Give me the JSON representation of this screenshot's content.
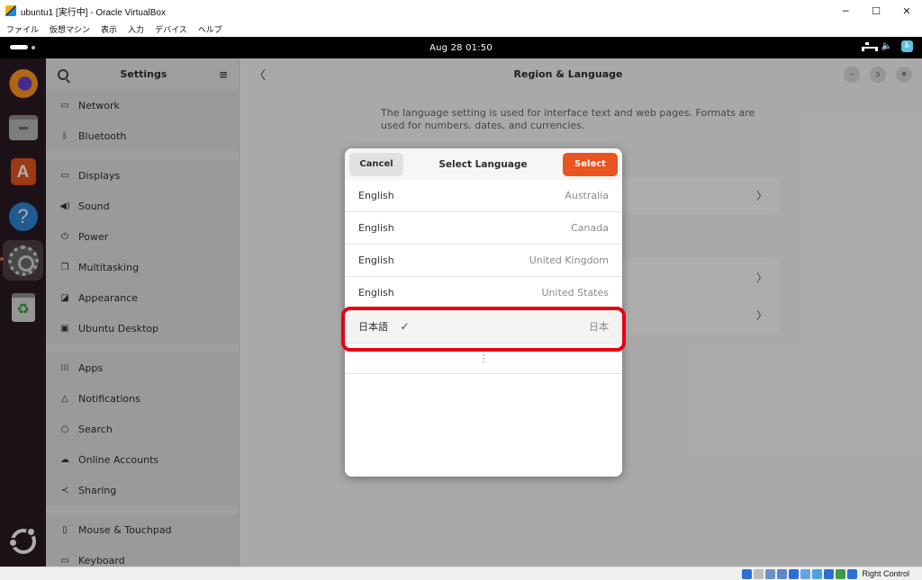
{
  "host": {
    "window_title": "ubuntu1 [実行中] - Oracle VirtualBox",
    "controls": {
      "minimize": "─",
      "maximize": "☐",
      "close": "✕"
    },
    "menu": [
      "ファイル",
      "仮想マシン",
      "表示",
      "入力",
      "デバイス",
      "ヘルプ"
    ],
    "status_hostkey": "Right Control"
  },
  "topbar": {
    "clock": "Aug 28  01:50",
    "tray": {
      "volume": "🔈",
      "accessibility": "♿"
    }
  },
  "dock": {
    "items": [
      {
        "name": "firefox-icon"
      },
      {
        "name": "files-icon"
      },
      {
        "name": "app-center-icon",
        "glyph": "A"
      },
      {
        "name": "help-icon",
        "glyph": "?"
      },
      {
        "name": "settings-icon"
      },
      {
        "name": "trash-icon",
        "glyph": "♻"
      },
      {
        "name": "ubuntu-icon"
      }
    ]
  },
  "settings": {
    "sidebar": {
      "title": "Settings",
      "menu_glyph": "≡",
      "groups": [
        [
          {
            "icon": "▭",
            "label": "Network"
          },
          {
            "icon": "ᛒ",
            "label": "Bluetooth"
          }
        ],
        [
          {
            "icon": "▭",
            "label": "Displays"
          },
          {
            "icon": "◀)",
            "label": "Sound"
          },
          {
            "icon": "⏻",
            "label": "Power"
          },
          {
            "icon": "❐",
            "label": "Multitasking"
          },
          {
            "icon": "◪",
            "label": "Appearance"
          },
          {
            "icon": "▣",
            "label": "Ubuntu Desktop"
          }
        ],
        [
          {
            "icon": "⁞⁞⁞",
            "label": "Apps"
          },
          {
            "icon": "△",
            "label": "Notifications"
          },
          {
            "icon": "○",
            "label": "Search"
          },
          {
            "icon": "☁",
            "label": "Online Accounts"
          },
          {
            "icon": "≺",
            "label": "Sharing"
          }
        ],
        [
          {
            "icon": "▯",
            "label": "Mouse & Touchpad"
          },
          {
            "icon": "▭",
            "label": "Keyboard"
          }
        ]
      ]
    },
    "main": {
      "back_glyph": "〈",
      "title": "Region & Language",
      "description": "The language setting is used for interface text and web pages. Formats are used for numbers, dates, and currencies.",
      "chevron": "〉",
      "window_buttons": [
        "–",
        "ᴐ",
        "✕"
      ]
    }
  },
  "dialog": {
    "title": "Select Language",
    "cancel": "Cancel",
    "select": "Select",
    "languages": [
      {
        "name": "English",
        "region": "Australia"
      },
      {
        "name": "English",
        "region": "Canada"
      },
      {
        "name": "English",
        "region": "United Kingdom"
      },
      {
        "name": "English",
        "region": "United States"
      },
      {
        "name": "日本語",
        "region": "日本",
        "selected": true
      }
    ],
    "check_glyph": "✓",
    "more_glyph": "⋮"
  },
  "colors": {
    "accent": "#e95420",
    "highlight": "#e60012",
    "dock_bg": "#2b1a24"
  }
}
